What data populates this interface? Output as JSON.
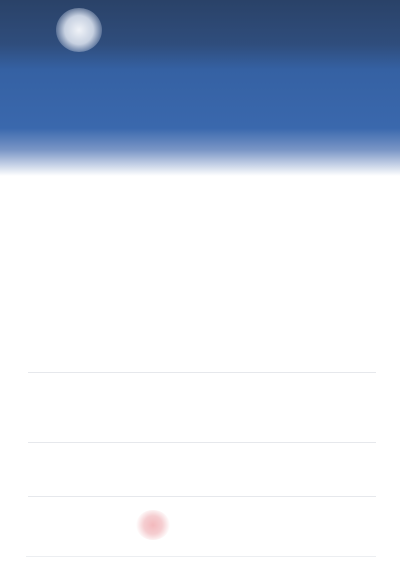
{
  "nav": {
    "left_label": "",
    "right_label": ""
  },
  "header": {
    "title": "",
    "subtitle": ""
  },
  "post": {
    "author": "",
    "timestamp": "",
    "action": "",
    "body": ""
  },
  "details": {
    "title": "",
    "rows": [
      {
        "label": "",
        "value": ""
      },
      {
        "label": "",
        "value": ""
      },
      {
        "label": "",
        "value": ""
      }
    ]
  },
  "icons": {
    "logo": "logo-icon",
    "status": "status-icon"
  },
  "colors": {
    "header_dark": "#2a4268",
    "header_blue": "#3a68ad",
    "accent_red": "#f3b9bd"
  }
}
